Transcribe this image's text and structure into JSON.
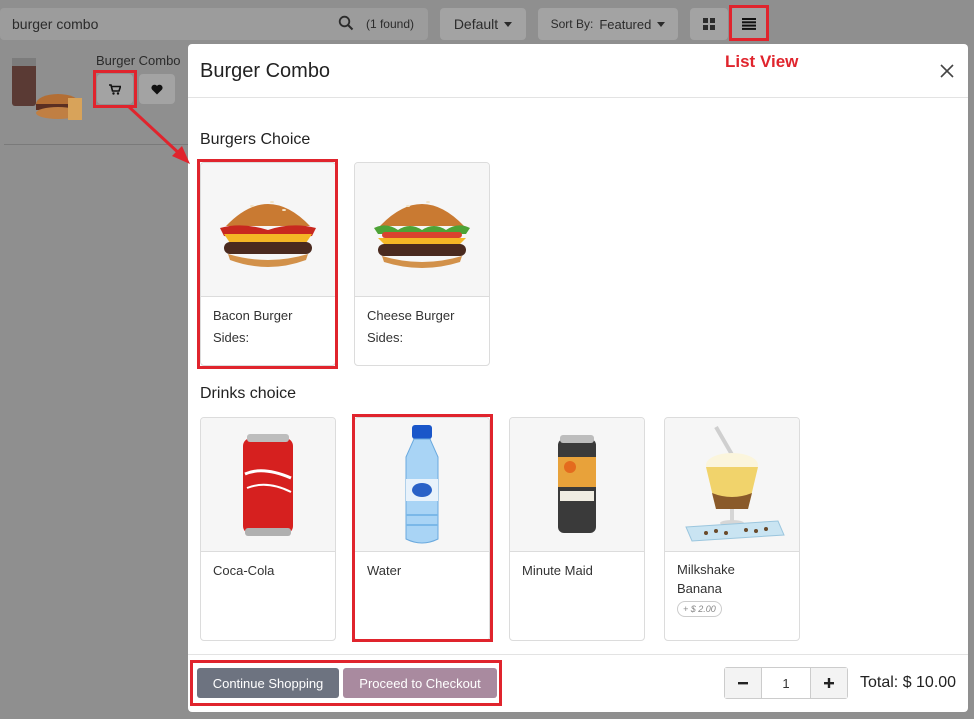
{
  "search": {
    "value": "burger combo",
    "count": "(1 found)"
  },
  "toolbar": {
    "pricelist_label": "Default",
    "sort_prefix": "Sort By:",
    "sort_value": "Featured"
  },
  "background_product": {
    "name": "Burger Combo"
  },
  "annotations": {
    "list_view_label": "List View",
    "color": "#e0242d"
  },
  "modal": {
    "title": "Burger Combo",
    "sections": [
      {
        "title": "Burgers Choice",
        "items": [
          {
            "name": "Bacon Burger",
            "sub": "Sides:"
          },
          {
            "name": "Cheese Burger",
            "sub": "Sides:"
          }
        ]
      },
      {
        "title": "Drinks choice",
        "items": [
          {
            "name": "Coca-Cola"
          },
          {
            "name": "Water"
          },
          {
            "name": "Minute Maid"
          },
          {
            "name": "Milkshake Banana",
            "price": "+ $ 2.00"
          }
        ]
      }
    ],
    "footer": {
      "continue_label": "Continue Shopping",
      "checkout_label": "Proceed to Checkout",
      "quantity": "1",
      "total": "Total: $ 10.00"
    }
  },
  "colors": {
    "continue_button": "#6d7380",
    "checkout_button": "#a98a9f"
  }
}
